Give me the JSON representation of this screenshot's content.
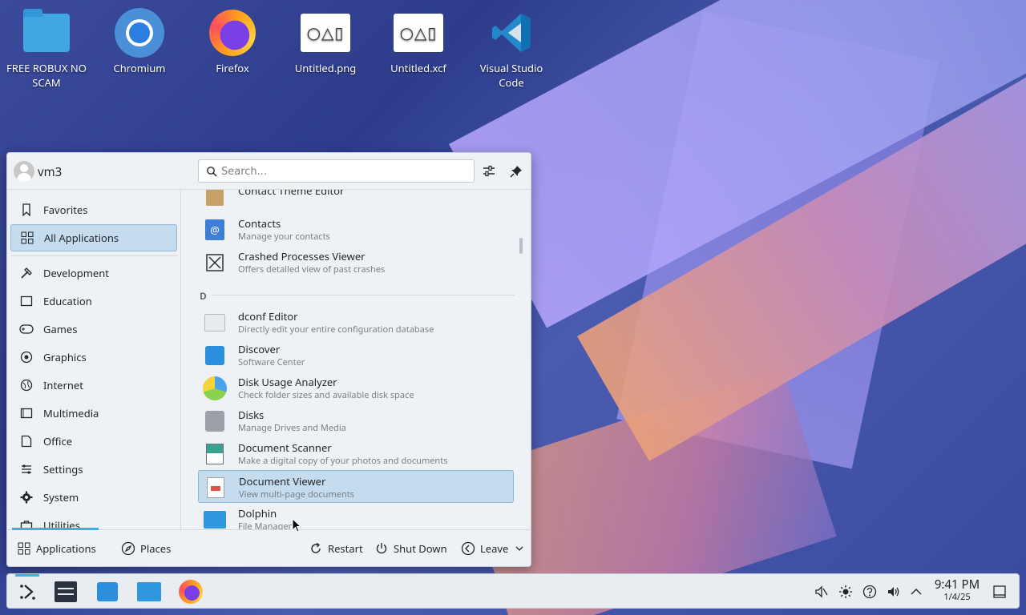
{
  "desktop": {
    "icons": [
      {
        "label": "FREE ROBUX NO SCAM",
        "icon": "folder-icon"
      },
      {
        "label": "Chromium",
        "icon": "chromium-icon"
      },
      {
        "label": "Firefox",
        "icon": "firefox-icon"
      },
      {
        "label": "Untitled.png",
        "icon": "image-file-icon"
      },
      {
        "label": "Untitled.xcf",
        "icon": "xcf-file-icon"
      },
      {
        "label": "Visual Studio Code",
        "icon": "vscode-icon"
      }
    ],
    "image_glyph": "○△▯"
  },
  "launcher": {
    "username": "vm3",
    "search_placeholder": "Search...",
    "categories": [
      {
        "label": "Favorites",
        "icon": "bookmark-icon"
      },
      {
        "label": "All Applications",
        "icon": "grid-icon",
        "active": true
      },
      {
        "label": "Development",
        "icon": "hammer-icon"
      },
      {
        "label": "Education",
        "icon": "education-icon"
      },
      {
        "label": "Games",
        "icon": "gamepad-icon"
      },
      {
        "label": "Graphics",
        "icon": "palette-icon"
      },
      {
        "label": "Internet",
        "icon": "globe-icon"
      },
      {
        "label": "Multimedia",
        "icon": "multimedia-icon"
      },
      {
        "label": "Office",
        "icon": "office-icon"
      },
      {
        "label": "Settings",
        "icon": "settings-icon"
      },
      {
        "label": "System",
        "icon": "gear-icon"
      },
      {
        "label": "Utilities",
        "icon": "toolbox-icon"
      }
    ],
    "apps": [
      {
        "name": "Contact Theme Editor",
        "desc": ""
      },
      {
        "name": "Contacts",
        "desc": "Manage your contacts"
      },
      {
        "name": "Crashed Processes Viewer",
        "desc": "Offers detailed view of past crashes"
      },
      {
        "name": "dconf Editor",
        "desc": "Directly edit your entire configuration database"
      },
      {
        "name": "Discover",
        "desc": "Software Center"
      },
      {
        "name": "Disk Usage Analyzer",
        "desc": "Check folder sizes and available disk space"
      },
      {
        "name": "Disks",
        "desc": "Manage Drives and Media"
      },
      {
        "name": "Document Scanner",
        "desc": "Make a digital copy of your photos and documents"
      },
      {
        "name": "Document Viewer",
        "desc": "View multi-page documents",
        "selected": true
      },
      {
        "name": "Dolphin",
        "desc": "File Manager"
      }
    ],
    "section_letter": "D",
    "footer": {
      "applications": "Applications",
      "places": "Places",
      "restart": "Restart",
      "shutdown": "Shut Down",
      "leave": "Leave"
    }
  },
  "taskbar": {
    "time": "9:41 PM",
    "date": "1/4/25"
  },
  "colors": {
    "accent": "#3daee9",
    "selection": "#c5dcef"
  }
}
